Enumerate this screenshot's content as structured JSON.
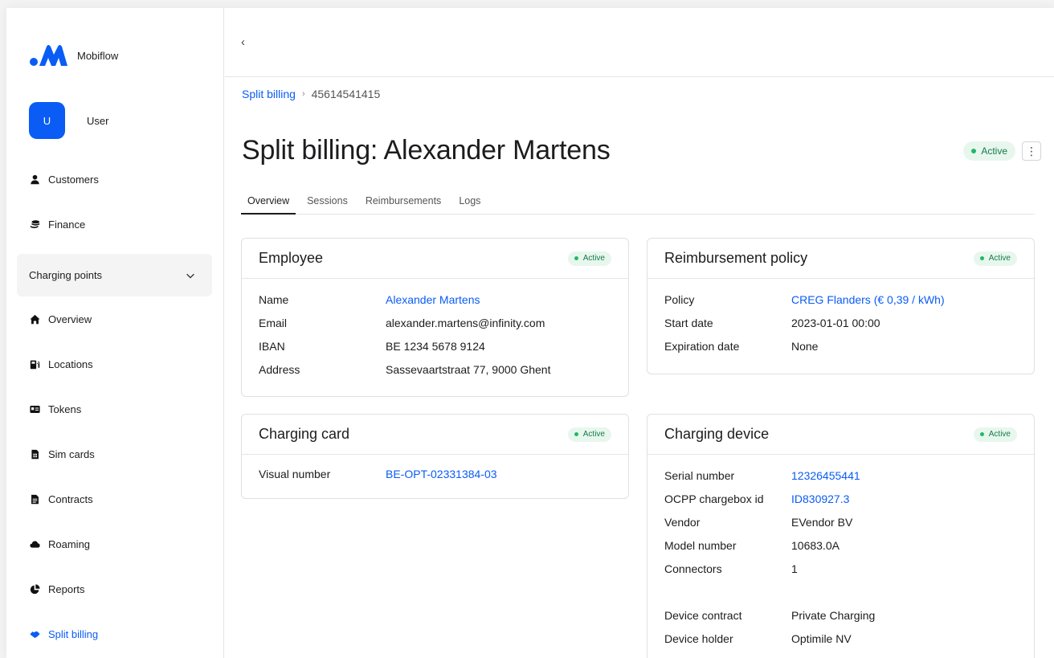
{
  "brand": {
    "name": "Mobiflow"
  },
  "user": {
    "initial": "U",
    "name": "User"
  },
  "sidebar": {
    "top_items": [
      {
        "label": "Customers",
        "icon": "person-icon"
      },
      {
        "label": "Finance",
        "icon": "coins-icon"
      }
    ],
    "group": {
      "label": "Charging points",
      "icon": "chevron-down-icon"
    },
    "items": [
      {
        "label": "Overview",
        "icon": "home-icon"
      },
      {
        "label": "Locations",
        "icon": "charging-station-icon"
      },
      {
        "label": "Tokens",
        "icon": "id-card-icon"
      },
      {
        "label": "Sim cards",
        "icon": "sim-card-icon"
      },
      {
        "label": "Contracts",
        "icon": "file-icon"
      },
      {
        "label": "Roaming",
        "icon": "cloud-icon"
      },
      {
        "label": "Reports",
        "icon": "pie-chart-icon"
      },
      {
        "label": "Split billing",
        "icon": "handshake-icon",
        "active": true
      }
    ]
  },
  "topbar": {
    "back": "‹"
  },
  "breadcrumb": {
    "parent": "Split billing",
    "separator": "›",
    "current": "45614541415"
  },
  "page": {
    "title": "Split billing: Alexander Martens",
    "status": "Active",
    "menu": "⋮"
  },
  "tabs": [
    "Overview",
    "Sessions",
    "Reimbursements",
    "Logs"
  ],
  "employee": {
    "title": "Employee",
    "status": "Active",
    "rows": [
      {
        "key": "Name",
        "value": "Alexander Martens",
        "link": true
      },
      {
        "key": "Email",
        "value": "alexander.martens@infinity.com"
      },
      {
        "key": "IBAN",
        "value": "BE 1234 5678 9124"
      },
      {
        "key": "Address",
        "value": "Sassevaartstraat 77, 9000 Ghent"
      }
    ]
  },
  "policy": {
    "title": "Reimbursement policy",
    "status": "Active",
    "rows": [
      {
        "key": "Policy",
        "value": "CREG Flanders (€ 0,39 / kWh)",
        "link": true
      },
      {
        "key": "Start date",
        "value": "2023-01-01 00:00"
      },
      {
        "key": "Expiration date",
        "value": "None"
      }
    ]
  },
  "card": {
    "title": "Charging card",
    "status": "Active",
    "rows": [
      {
        "key": "Visual number",
        "value": "BE-OPT-02331384-03",
        "link": true
      }
    ]
  },
  "device": {
    "title": "Charging device",
    "status": "Active",
    "rows": [
      {
        "key": "Serial number",
        "value": "12326455441",
        "link": true
      },
      {
        "key": "OCPP chargebox id",
        "value": "ID830927.3",
        "link": true
      },
      {
        "key": "Vendor",
        "value": "EVendor BV"
      },
      {
        "key": "Model number",
        "value": "10683.0A"
      },
      {
        "key": "Connectors",
        "value": "1"
      }
    ],
    "rows2": [
      {
        "key": "Device contract",
        "value": "Private Charging"
      },
      {
        "key": "Device holder",
        "value": "Optimile NV"
      }
    ]
  },
  "colors": {
    "accent": "#0a5cf5",
    "success_bg": "#e8f7ee",
    "success_text": "#16794a",
    "success_dot": "#22b864"
  }
}
